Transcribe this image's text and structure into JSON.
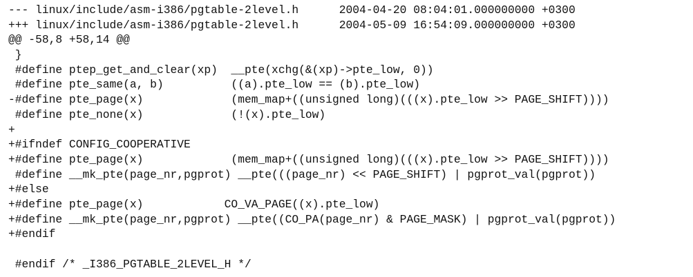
{
  "diff": {
    "header_old": "--- linux/include/asm-i386/pgtable-2level.h      2004-04-20 08:04:01.000000000 +0300",
    "header_new": "+++ linux/include/asm-i386/pgtable-2level.h      2004-05-09 16:54:09.000000000 +0300",
    "hunk": "@@ -58,8 +58,14 @@",
    "lines": [
      " }",
      " #define ptep_get_and_clear(xp)  __pte(xchg(&(xp)->pte_low, 0))",
      " #define pte_same(a, b)          ((a).pte_low == (b).pte_low)",
      "-#define pte_page(x)             (mem_map+((unsigned long)(((x).pte_low >> PAGE_SHIFT))))",
      " #define pte_none(x)             (!(x).pte_low)",
      "+",
      "+#ifndef CONFIG_COOPERATIVE",
      "+#define pte_page(x)             (mem_map+((unsigned long)(((x).pte_low >> PAGE_SHIFT))))",
      " #define __mk_pte(page_nr,pgprot) __pte(((page_nr) << PAGE_SHIFT) | pgprot_val(pgprot))",
      "+#else",
      "+#define pte_page(x)            CO_VA_PAGE((x).pte_low)",
      "+#define __mk_pte(page_nr,pgprot) __pte((CO_PA(page_nr) & PAGE_MASK) | pgprot_val(pgprot))",
      "+#endif",
      "",
      " #endif /* _I386_PGTABLE_2LEVEL_H */"
    ]
  }
}
